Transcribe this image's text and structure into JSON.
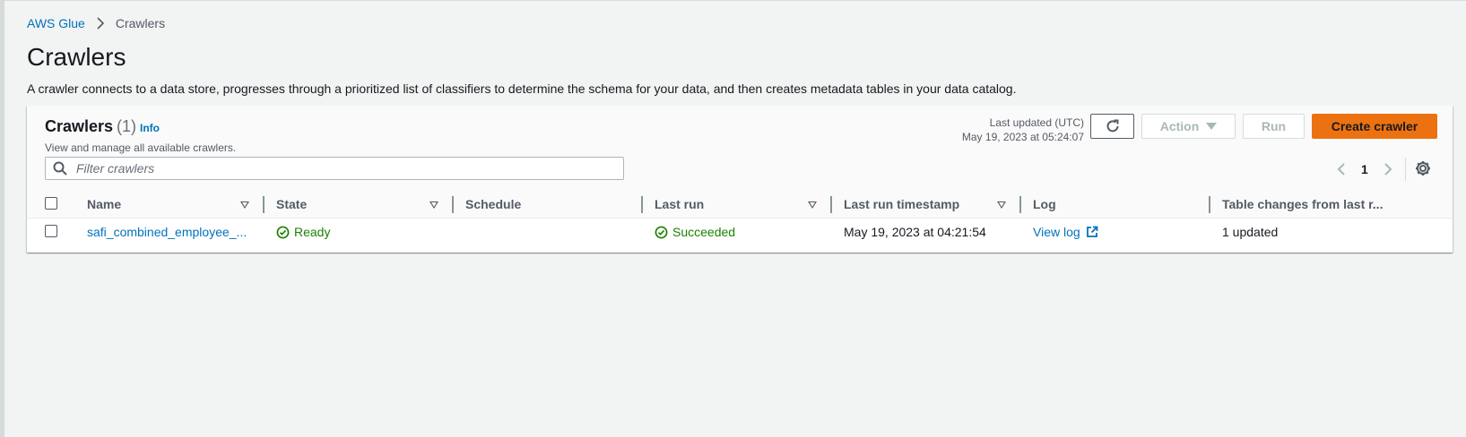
{
  "breadcrumb": {
    "root": "AWS Glue",
    "current": "Crawlers"
  },
  "page": {
    "title": "Crawlers",
    "description": "A crawler connects to a data store, progresses through a prioritized list of classifiers to determine the schema for your data, and then creates metadata tables in your data catalog."
  },
  "panel": {
    "title": "Crawlers",
    "count": "(1)",
    "info": "Info",
    "subtitle": "View and manage all available crawlers.",
    "last_updated_label": "Last updated (UTC)",
    "last_updated_value": "May 19, 2023 at 05:24:07",
    "action_label": "Action",
    "run_label": "Run",
    "create_label": "Create crawler",
    "search_placeholder": "Filter crawlers",
    "page_number": "1"
  },
  "table": {
    "columns": {
      "name": "Name",
      "state": "State",
      "schedule": "Schedule",
      "last_run": "Last run",
      "last_run_timestamp": "Last run timestamp",
      "log": "Log",
      "table_changes": "Table changes from last r..."
    },
    "rows": [
      {
        "name": "safi_combined_employee_...",
        "state": "Ready",
        "schedule": "",
        "last_run": "Succeeded",
        "last_run_timestamp": "May 19, 2023 at 04:21:54",
        "log": "View log",
        "table_changes": "1 updated"
      }
    ]
  },
  "colors": {
    "link": "#0073bb",
    "success": "#1d8102",
    "primary_button": "#ec7211",
    "background": "#f2f3f3"
  }
}
